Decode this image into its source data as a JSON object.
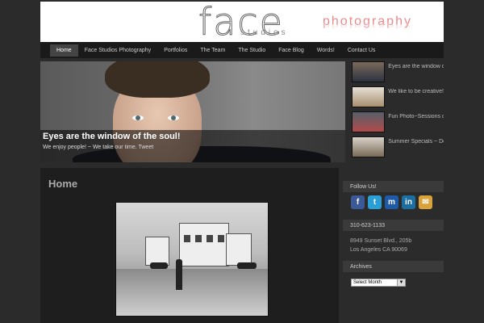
{
  "header": {
    "logo_face": "face",
    "logo_studios": "studios",
    "logo_photography": "photography"
  },
  "nav": {
    "items": [
      "Home",
      "Face Studios Photography",
      "Portfolios",
      "The Team",
      "The Studio",
      "Face Blog",
      "Words!",
      "Contact Us"
    ]
  },
  "slider": {
    "title": "Eyes are the window of the soul!",
    "subtitle": "We enjoy people! ~ We take our time. Tweet"
  },
  "thumbs": [
    {
      "label": "Eyes are the window of"
    },
    {
      "label": "We like to be creative!"
    },
    {
      "label": "Fun Photo~Sessions on"
    },
    {
      "label": "Summer Specials ~ Dor"
    }
  ],
  "main": {
    "title": "Home"
  },
  "sidebar": {
    "follow_title": "Follow Us!",
    "phone_title": "310-623-1133",
    "address_line1": "8949 Sunset Blvd., 205b",
    "address_line2": "Los Angeles CA 90069",
    "archives_title": "Archives",
    "select_value": "Select Month"
  },
  "social_icons": [
    "facebook-icon",
    "twitter-icon",
    "myspace-icon",
    "linkedin-icon",
    "email-icon"
  ],
  "colors": {
    "accent": "#e88a8a",
    "facebook": "#3b5998",
    "twitter": "#2a9fd6",
    "myspace": "#1e5aa8",
    "linkedin": "#1c6ea0",
    "email": "#d9a23a"
  }
}
